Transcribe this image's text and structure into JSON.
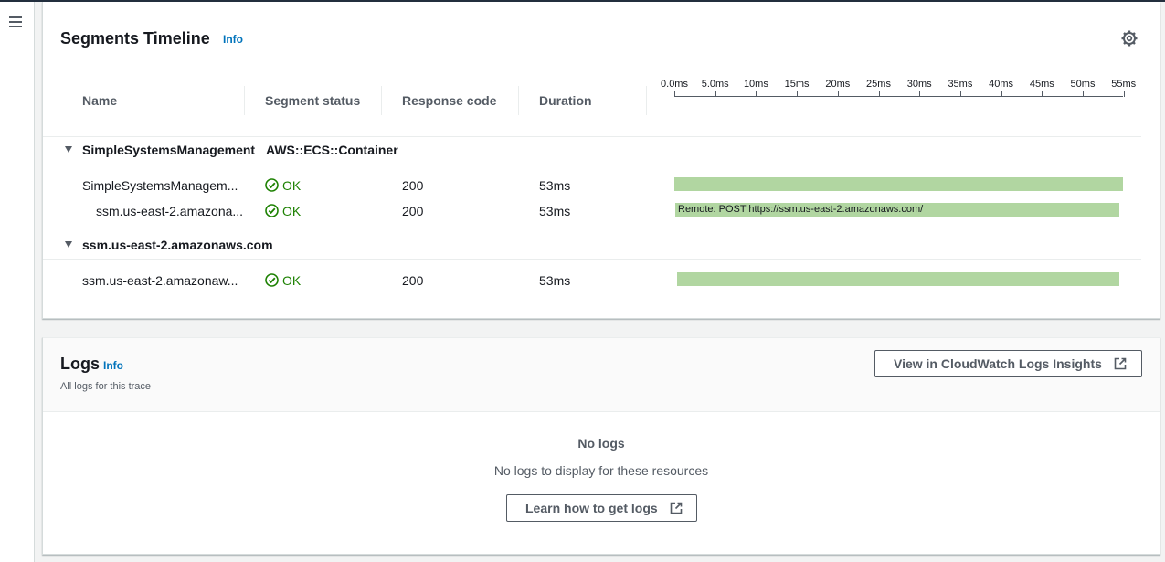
{
  "timeline": {
    "title": "Segments Timeline",
    "info_label": "Info",
    "columns": [
      "Name",
      "Segment status",
      "Response code",
      "Duration"
    ],
    "ticks": [
      "0.0ms",
      "5.0ms",
      "10ms",
      "15ms",
      "20ms",
      "25ms",
      "30ms",
      "35ms",
      "40ms",
      "45ms",
      "50ms",
      "55ms"
    ],
    "groups": [
      {
        "name": "SimpleSystemsManagement",
        "type": "AWS::ECS::Container",
        "rows": [
          {
            "name": "SimpleSystemsManagem...",
            "status": "OK",
            "code": "200",
            "duration": "53ms",
            "bar_label": ""
          },
          {
            "name": "ssm.us-east-2.amazona...",
            "status": "OK",
            "code": "200",
            "duration": "53ms",
            "bar_label": "Remote: POST https://ssm.us-east-2.amazonaws.com/"
          }
        ]
      },
      {
        "name": "ssm.us-east-2.amazonaws.com",
        "type": "",
        "rows": [
          {
            "name": "ssm.us-east-2.amazonaw...",
            "status": "OK",
            "code": "200",
            "duration": "53ms",
            "bar_label": ""
          }
        ]
      }
    ],
    "colors": {
      "bar": "#b1d6a1",
      "ok": "#1d8102",
      "link": "#0073bb"
    }
  },
  "logs": {
    "title": "Logs",
    "info_label": "Info",
    "subtitle": "All logs for this trace",
    "view_button": "View in CloudWatch Logs Insights",
    "empty_title": "No logs",
    "empty_text": "No logs to display for these resources",
    "learn_button": "Learn how to get logs"
  },
  "icons": [
    "menu-icon",
    "gear-icon",
    "status-ok-icon",
    "caret-down-icon",
    "external-link-icon"
  ]
}
